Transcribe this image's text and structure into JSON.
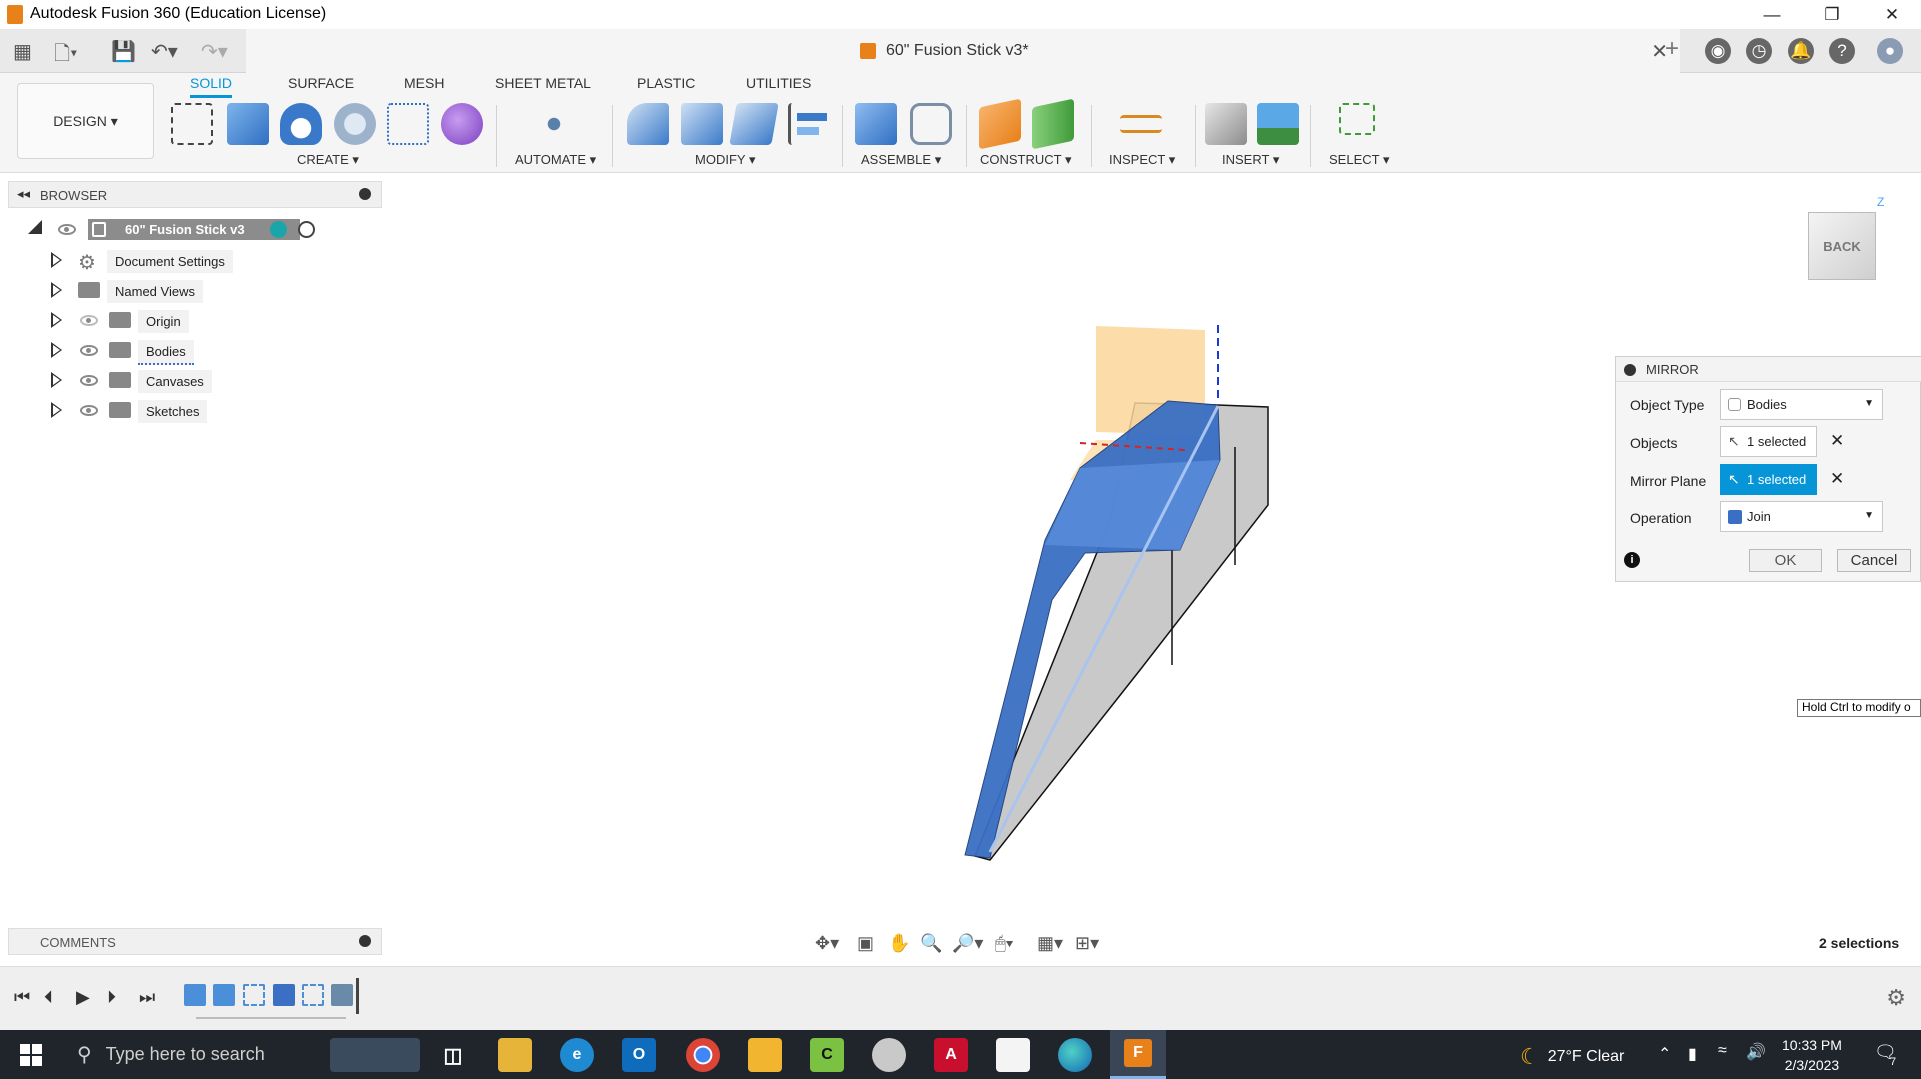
{
  "window": {
    "title": "Autodesk Fusion 360 (Education License)"
  },
  "document": {
    "title": "60\" Fusion Stick v3*"
  },
  "ribbon": {
    "workspace": "DESIGN",
    "tabs": [
      "SOLID",
      "SURFACE",
      "MESH",
      "SHEET METAL",
      "PLASTIC",
      "UTILITIES"
    ],
    "groups": [
      "CREATE",
      "AUTOMATE",
      "MODIFY",
      "ASSEMBLE",
      "CONSTRUCT",
      "INSPECT",
      "INSERT",
      "SELECT"
    ]
  },
  "browser": {
    "title": "BROWSER",
    "root": "60\" Fusion Stick v3",
    "items": [
      "Document Settings",
      "Named Views",
      "Origin",
      "Bodies",
      "Canvases",
      "Sketches"
    ]
  },
  "viewcube": {
    "face": "BACK",
    "axis": "Z"
  },
  "mirror": {
    "title": "MIRROR",
    "object_type_label": "Object Type",
    "object_type_value": "Bodies",
    "objects_label": "Objects",
    "objects_value": "1 selected",
    "plane_label": "Mirror Plane",
    "plane_value": "1 selected",
    "operation_label": "Operation",
    "operation_value": "Join",
    "ok": "OK",
    "cancel": "Cancel"
  },
  "tooltip": "Hold Ctrl to modify o",
  "comments": {
    "title": "COMMENTS"
  },
  "status": {
    "selections": "2 selections"
  },
  "taskbar": {
    "search_placeholder": "Type here to search",
    "weather": "27°F  Clear",
    "time": "10:33 PM",
    "date": "2/3/2023",
    "notifications": "7"
  },
  "colors": {
    "accent": "#0696d7",
    "body_blue": "#3a6fc4",
    "plane_orange": "#fbd79a"
  }
}
